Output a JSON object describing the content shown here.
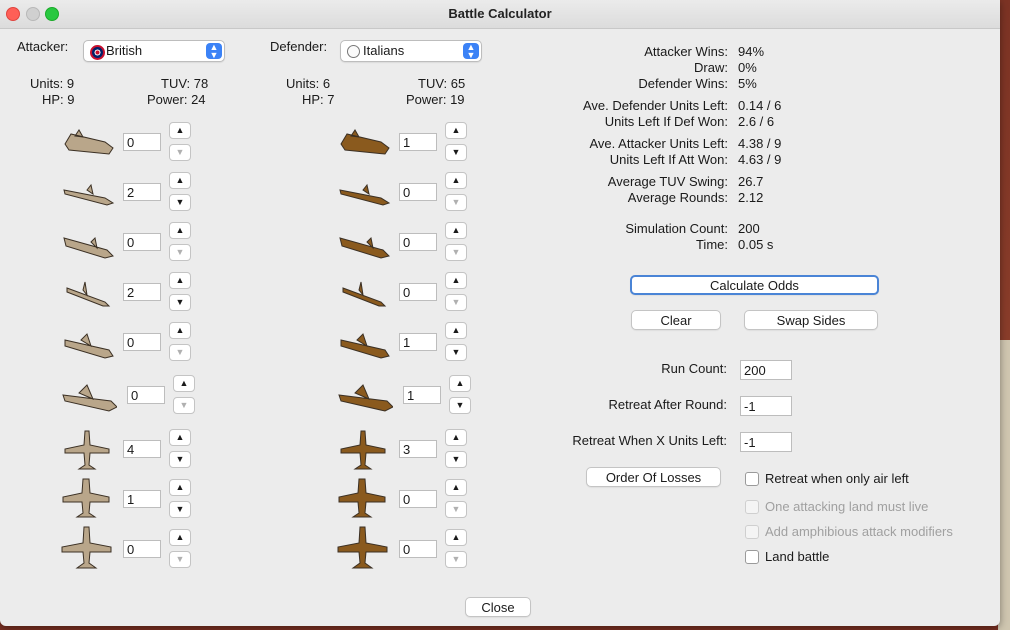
{
  "window": {
    "title": "Battle Calculator"
  },
  "attacker": {
    "label": "Attacker:",
    "nation": "British",
    "units_text": "Units: 9",
    "tuv_text": "TUV: 78",
    "hp_text": "HP: 9",
    "power_text": "Power: 24",
    "units": [
      {
        "icon": "transport-ship-icon",
        "count": "0",
        "down_enabled": false
      },
      {
        "icon": "submarine-icon",
        "count": "2",
        "down_enabled": true
      },
      {
        "icon": "aircraft-carrier-icon",
        "count": "0",
        "down_enabled": false
      },
      {
        "icon": "destroyer-icon",
        "count": "2",
        "down_enabled": true
      },
      {
        "icon": "cruiser-icon",
        "count": "0",
        "down_enabled": false
      },
      {
        "icon": "battleship-icon",
        "count": "0",
        "down_enabled": false
      },
      {
        "icon": "fighter-icon",
        "count": "4",
        "down_enabled": true
      },
      {
        "icon": "tactical-bomber-icon",
        "count": "1",
        "down_enabled": true
      },
      {
        "icon": "strategic-bomber-icon",
        "count": "0",
        "down_enabled": false
      }
    ]
  },
  "defender": {
    "label": "Defender:",
    "nation": "Italians",
    "units_text": "Units: 6",
    "tuv_text": "TUV: 65",
    "hp_text": "HP: 7",
    "power_text": "Power: 19",
    "units": [
      {
        "icon": "transport-ship-icon",
        "count": "1",
        "down_enabled": true
      },
      {
        "icon": "submarine-icon",
        "count": "0",
        "down_enabled": false
      },
      {
        "icon": "aircraft-carrier-icon",
        "count": "0",
        "down_enabled": false
      },
      {
        "icon": "destroyer-icon",
        "count": "0",
        "down_enabled": false
      },
      {
        "icon": "cruiser-icon",
        "count": "1",
        "down_enabled": true
      },
      {
        "icon": "battleship-icon",
        "count": "1",
        "down_enabled": true
      },
      {
        "icon": "fighter-icon",
        "count": "3",
        "down_enabled": true
      },
      {
        "icon": "tactical-bomber-icon",
        "count": "0",
        "down_enabled": false
      },
      {
        "icon": "strategic-bomber-icon",
        "count": "0",
        "down_enabled": false
      }
    ]
  },
  "results": [
    {
      "label": "Attacker Wins:",
      "value": "94%"
    },
    {
      "label": "Draw:",
      "value": "0%"
    },
    {
      "label": "Defender Wins:",
      "value": "5%"
    },
    {
      "label": "Ave. Defender Units Left:",
      "value": "0.14 / 6"
    },
    {
      "label": "Units Left If Def Won:",
      "value": "2.6 / 6"
    },
    {
      "label": "Ave. Attacker Units Left:",
      "value": "4.38 / 9"
    },
    {
      "label": "Units Left If Att Won:",
      "value": "4.63 / 9"
    },
    {
      "label": "Average TUV Swing:",
      "value": "26.7"
    },
    {
      "label": "Average Rounds:",
      "value": "2.12"
    },
    {
      "label": "Simulation Count:",
      "value": "200"
    },
    {
      "label": "Time:",
      "value": "0.05 s"
    }
  ],
  "buttons": {
    "calculate": "Calculate Odds",
    "clear": "Clear",
    "swap": "Swap Sides",
    "order_of_losses": "Order Of Losses",
    "close": "Close"
  },
  "settings": {
    "run_count_label": "Run Count:",
    "run_count_value": "200",
    "retreat_round_label": "Retreat After Round:",
    "retreat_round_value": "-1",
    "retreat_units_label": "Retreat When X Units Left:",
    "retreat_units_value": "-1"
  },
  "checkboxes": [
    {
      "label": "Retreat when only air left",
      "checked": false,
      "enabled": true
    },
    {
      "label": "One attacking land must live",
      "checked": false,
      "enabled": false
    },
    {
      "label": "Add amphibious attack modifiers",
      "checked": false,
      "enabled": false
    },
    {
      "label": "Land battle",
      "checked": false,
      "enabled": true
    }
  ],
  "colors": {
    "attacker_unit": "#b9a68a",
    "defender_unit": "#8a5a1e",
    "focus_border": "#4a84d6",
    "combo_arrow": "#3b82f6"
  }
}
